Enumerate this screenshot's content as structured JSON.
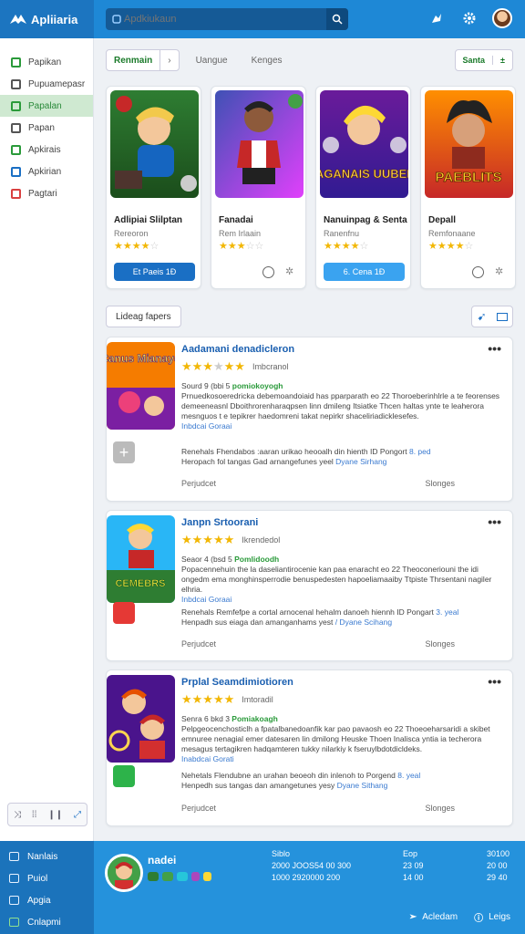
{
  "brand": {
    "title": "Apliiaria"
  },
  "search": {
    "placeholder": "Apdkiukaun"
  },
  "sidebar": {
    "items": [
      {
        "label": "Papikan",
        "color": "#2a9a3a"
      },
      {
        "label": "Pupuamepasr",
        "color": "#555"
      },
      {
        "label": "Papalan",
        "color": "#2a9a3a"
      },
      {
        "label": "Papan",
        "color": "#555"
      },
      {
        "label": "Apkirais",
        "color": "#2a9a3a"
      },
      {
        "label": "Apkirian",
        "color": "#1a6fc4"
      },
      {
        "label": "Pagtari",
        "color": "#d94040"
      }
    ],
    "footer_icons": [
      "shuffle-icon",
      "grid-icon",
      "pause-icon",
      "expand-icon"
    ]
  },
  "tabs": {
    "items": [
      "Renmain",
      "Uangue",
      "Kenges"
    ],
    "arrow": "›"
  },
  "right_button": {
    "label": "Santa",
    "icon": "±"
  },
  "cards": [
    {
      "title": "Adlipiai Slilptan",
      "sub": "Rereoron",
      "rating": 4,
      "button": "Et Paeis 1Ð",
      "button_style": "dark",
      "art": "pirate"
    },
    {
      "title": "Fanadai",
      "sub": "Rem Irlaain",
      "rating": 3,
      "button": "",
      "button_style": "none",
      "art": "hero"
    },
    {
      "title": "Nanuinpag & Senta",
      "sub": "Ranenfnu",
      "rating": 4,
      "button": "6. Cena 1Ð",
      "button_style": "light",
      "art": "wagnais",
      "art_text": "VIAGANAIS UUBEKS"
    },
    {
      "title": "Depall",
      "sub": "Remfonaane",
      "rating": 4,
      "button": "",
      "button_style": "none",
      "art": "paeblits",
      "art_text": "PAEBLITS"
    }
  ],
  "section": {
    "title": "Lideag fapers"
  },
  "list": [
    {
      "title": "Aadamani denadicleron",
      "more": "•••",
      "rating": 3,
      "meta": "Imbcranol",
      "line1": "Sourd 9 (bbi 5 ",
      "line1g": "pomiokoyogh",
      "body": "Prnuedkosoeredricka debemoandoiaid has pparparath eo 22 Thoroeberinhlrle a te feorenses demeeneasnl Dboithrorenharaqpsen linn dmileng Itsiatke Thcen haltas ynte te leaherora mesnguos t e tepikrer haedomreni takat nepirkr shaceliriadicklesefes.",
      "link": "Inbdcai Goraai",
      "l2": "Renehals Fhendabos :aaran urikao heooalh din hienth ID Pongort ",
      "l2b": "8. ped",
      "l3": "Heropach fol tangas Gad arnangefunes yeel ",
      "l3b": "Dyane Sirhang",
      "f1": "Perjudcet",
      "f2": "Slonges",
      "art": "magic",
      "art_text": "Canus Mianaye",
      "sub_icon": "plus",
      "sub_color": "#bbb"
    },
    {
      "title": "Janpn Srtoorani",
      "more": "•••",
      "rating": 5,
      "meta": "Ikrendedol",
      "line1": "Seaor 4 (bsd 5 ",
      "line1g": "Pomlidoodh",
      "body": "Popacennehuin the la daseliantirocenie kan paa enaracht eo 22 Theoconeriouni the idi ongedm ema monghinsperrodie benuspedesten hapoeliamaaiby Ttpiste Thrsentani nagiler elhria.",
      "link": "Inbdcai Goraai",
      "l2": "Renehals Remfefpe a cortal arnocenal hehalm danoeh hiennh ID Pongart ",
      "l2b": "3. yeal",
      "l3": "Henpadh sus eiaga dan amanganhams yest ",
      "l3b": "/ Dyane Scihang",
      "f1": "Perjudcet",
      "f2": "Slonges",
      "art": "comics",
      "art_text": "CEMEBRS",
      "sub_icon": "app",
      "sub_color": "#e53935"
    },
    {
      "title": "Prplal Seamdimiotioren",
      "more": "•••",
      "rating": 5,
      "meta": "Imtoradil",
      "line1": "Senra 6 bkd 3 ",
      "line1g": "Pomiakoagh",
      "body": "Pelpgeocenchosticlh a fpatalbanedoanfik kar pao pavaosh eo 22 Thoeoeharsaridi a skibet emnuree nenagial emer datesaren lin dmilong Heuske Thoen Inalisca yntia ia techerora mesagus tertagikren hadqamteren tukky nilarkiy k fseruylbdotdicldeks.",
      "link": "Inabdcai Gorati",
      "l2": "Nehetals Flendubne an urahan beoeoh din inlenoh to Porgend ",
      "l2b": "8. yeal",
      "l3": "Henpedh sus tangas dan amangetunes yesy ",
      "l3b": "Dyane Sithang",
      "f1": "Perjudcet",
      "f2": "Slonges",
      "art": "duo",
      "art_text": "",
      "sub_icon": "chat",
      "sub_color": "#2db34a"
    }
  ],
  "bottom": {
    "side": [
      {
        "label": "Nanlais"
      },
      {
        "label": "Puiol"
      },
      {
        "label": "Apgia"
      },
      {
        "label": "Cnlapmi"
      }
    ],
    "player": "nadei",
    "stats": [
      {
        "label": "Siblo",
        "values": "2000 JOOS54 00 300\n1000 2920000 200"
      },
      {
        "label": "Eop",
        "values": "23 09\n14 00"
      },
      {
        "label": "30100",
        "values": "20 00\n29 40"
      }
    ],
    "actions": [
      {
        "label": "Acledam"
      },
      {
        "label": "Leigs"
      }
    ]
  }
}
